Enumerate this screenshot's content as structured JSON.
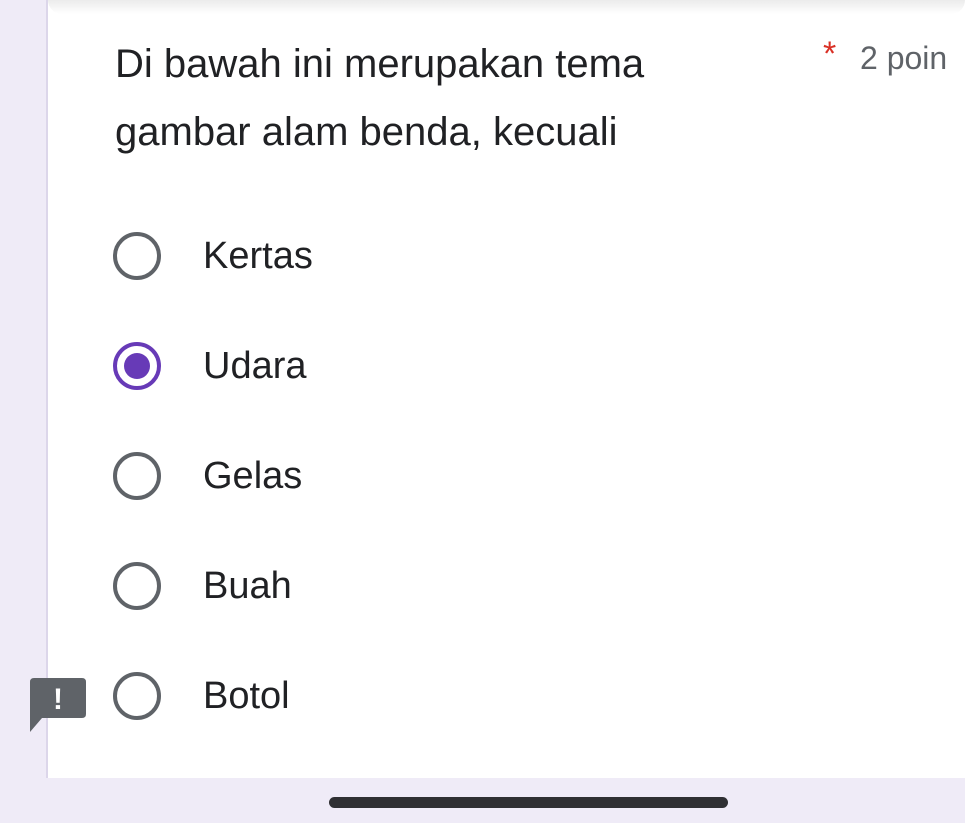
{
  "question": {
    "title": "Di bawah ini merupakan tema gambar alam benda, kecuali",
    "required_mark": "*",
    "points_label": "2 poin"
  },
  "options": [
    {
      "label": "Kertas",
      "selected": false
    },
    {
      "label": "Udara",
      "selected": true
    },
    {
      "label": "Gelas",
      "selected": false
    },
    {
      "label": "Buah",
      "selected": false
    },
    {
      "label": "Botol",
      "selected": false
    }
  ],
  "feedback_icon": {
    "glyph": "!",
    "icon": "report-feedback-icon"
  },
  "colors": {
    "accent": "#673ab7",
    "required": "#d93025",
    "background": "#efebf7"
  }
}
